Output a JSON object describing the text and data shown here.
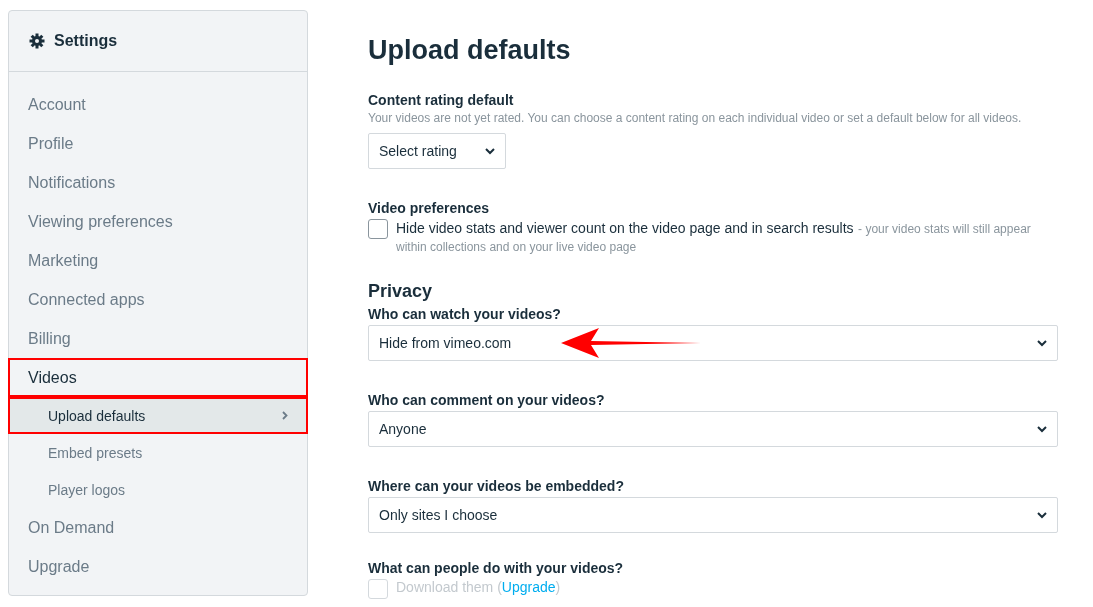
{
  "sidebar": {
    "title": "Settings",
    "items": [
      {
        "label": "Account",
        "kind": "item",
        "selected": false,
        "highlighted": false
      },
      {
        "label": "Profile",
        "kind": "item",
        "selected": false,
        "highlighted": false
      },
      {
        "label": "Notifications",
        "kind": "item",
        "selected": false,
        "highlighted": false
      },
      {
        "label": "Viewing preferences",
        "kind": "item",
        "selected": false,
        "highlighted": false
      },
      {
        "label": "Marketing",
        "kind": "item",
        "selected": false,
        "highlighted": false
      },
      {
        "label": "Connected apps",
        "kind": "item",
        "selected": false,
        "highlighted": false
      },
      {
        "label": "Billing",
        "kind": "item",
        "selected": false,
        "highlighted": false
      },
      {
        "label": "Videos",
        "kind": "item",
        "selected": false,
        "highlighted": true
      },
      {
        "label": "Upload defaults",
        "kind": "sub",
        "selected": true,
        "highlighted": true
      },
      {
        "label": "Embed presets",
        "kind": "sub",
        "selected": false,
        "highlighted": false
      },
      {
        "label": "Player logos",
        "kind": "sub",
        "selected": false,
        "highlighted": false
      },
      {
        "label": "On Demand",
        "kind": "item",
        "selected": false,
        "highlighted": false
      },
      {
        "label": "Upgrade",
        "kind": "item",
        "selected": false,
        "highlighted": false
      }
    ]
  },
  "main": {
    "title": "Upload defaults",
    "content_rating": {
      "label": "Content rating default",
      "description": "Your videos are not yet rated. You can choose a content rating on each individual video or set a default below for all videos.",
      "value": "Select rating"
    },
    "video_preferences": {
      "label": "Video preferences",
      "checked": false,
      "text": "Hide video stats and viewer count on the video page and in search results",
      "note": "- your video stats will still appear within collections and on your live video page"
    },
    "privacy": {
      "heading": "Privacy",
      "fields": [
        {
          "label": "Who can watch your videos?",
          "value": "Hide from vimeo.com",
          "annotated": true
        },
        {
          "label": "Who can comment on your videos?",
          "value": "Anyone",
          "annotated": false
        },
        {
          "label": "Where can your videos be embedded?",
          "value": "Only sites I choose",
          "annotated": false
        }
      ],
      "actions": {
        "label": "What can people do with your videos?",
        "option": "Download them (",
        "link": "Upgrade",
        "close": ")",
        "checked": false,
        "disabled": true
      }
    }
  }
}
